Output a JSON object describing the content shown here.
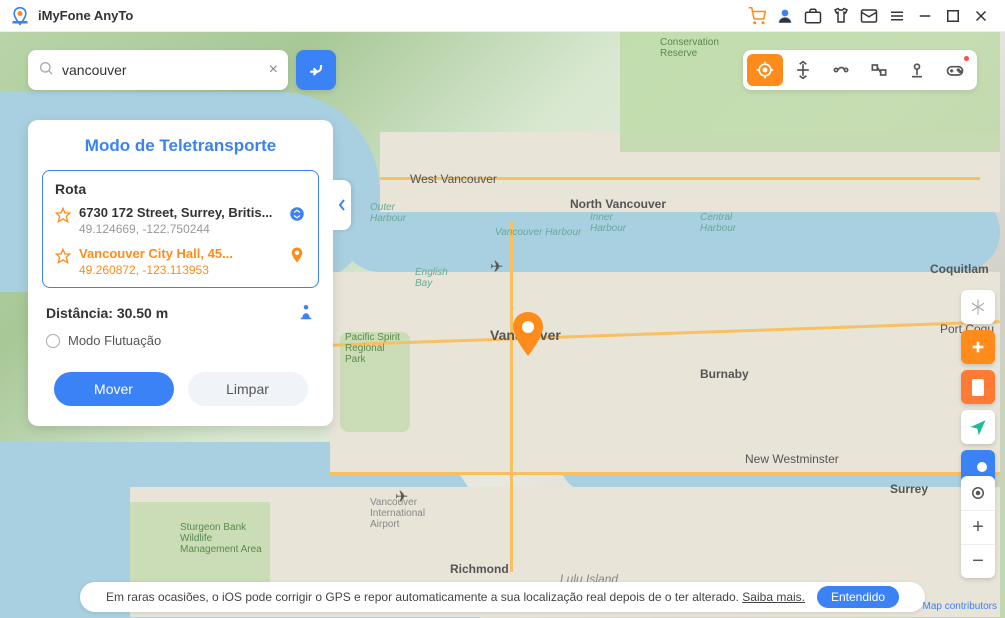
{
  "app": {
    "title": "iMyFone AnyTo"
  },
  "search": {
    "value": "vancouver"
  },
  "panel": {
    "title": "Modo de Teletransporte",
    "route_label": "Rota",
    "origin": {
      "address": "6730 172 Street, Surrey, Britis...",
      "coords": "49.124669, -122.750244"
    },
    "dest": {
      "address": "Vancouver City Hall, 45...",
      "coords": "49.260872, -123.113953"
    },
    "distance_label": "Distância:",
    "distance_value": "30.50 m",
    "float_label": "Modo Flutuação",
    "move_btn": "Mover",
    "clear_btn": "Limpar"
  },
  "map_labels": {
    "west_van": "West Vancouver",
    "north_van": "North Vancouver",
    "vancouver": "Vancouver",
    "burnaby": "Burnaby",
    "richmond": "Richmond",
    "surrey": "Surrey",
    "new_west": "New Westminster",
    "coquitlam": "Coquitlam",
    "port_coq": "Port Coqu",
    "lulu": "Lulu Island",
    "van_harbour": "Vancouver Harbour",
    "outer_harbour": "Outer Harbour",
    "inner_harbour": "Inner Harbour",
    "central_harbour": "Central Harbour",
    "english_bay": "English Bay",
    "pacific_park": "Pacific Spirit Regional Park",
    "sturgeon": "Sturgeon Bank Wildlife Management Area",
    "van_airport": "Vancouver International Airport",
    "conservation": "Conservation Reserve"
  },
  "footer": {
    "text": "Em raras ocasiões, o iOS pode corrigir o GPS e repor automaticamente a sua localização real depois de o ter alterado.",
    "link": "Saiba mais.",
    "ok": "Entendido"
  },
  "attrib": "Map contributors"
}
